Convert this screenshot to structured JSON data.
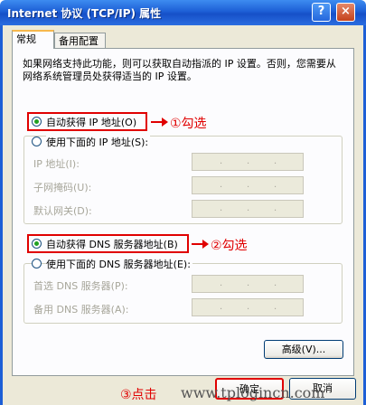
{
  "window": {
    "title": "Internet 协议 (TCP/IP) 属性"
  },
  "tabs": [
    "常规",
    "备用配置"
  ],
  "description": "如果网络支持此功能，则可以获取自动指派的 IP 设置。否则，您需要从网络系统管理员处获得适当的 IP 设置。",
  "ip": {
    "auto_label": "自动获得 IP 地址(O)",
    "manual_label": "使用下面的 IP 地址(S):",
    "fields": [
      "IP 地址(I):",
      "子网掩码(U):",
      "默认网关(D):"
    ],
    "selected": "auto"
  },
  "dns": {
    "auto_label": "自动获得 DNS 服务器地址(B)",
    "manual_label": "使用下面的 DNS 服务器地址(E):",
    "fields": [
      "首选 DNS 服务器(P):",
      "备用 DNS 服务器(A):"
    ],
    "selected": "auto"
  },
  "annotations": {
    "first": "①勾选",
    "second": "②勾选",
    "third": "③点击"
  },
  "buttons": {
    "advanced": "高级(V)...",
    "ok": "确定",
    "cancel": "取消"
  },
  "watermark": "www.tplogincn.com",
  "colors": {
    "annotation": "#e00000",
    "title_bar": "#1d5fd6",
    "window_bg": "#ece9d8"
  },
  "icons": {
    "help": "?",
    "close": "×"
  }
}
